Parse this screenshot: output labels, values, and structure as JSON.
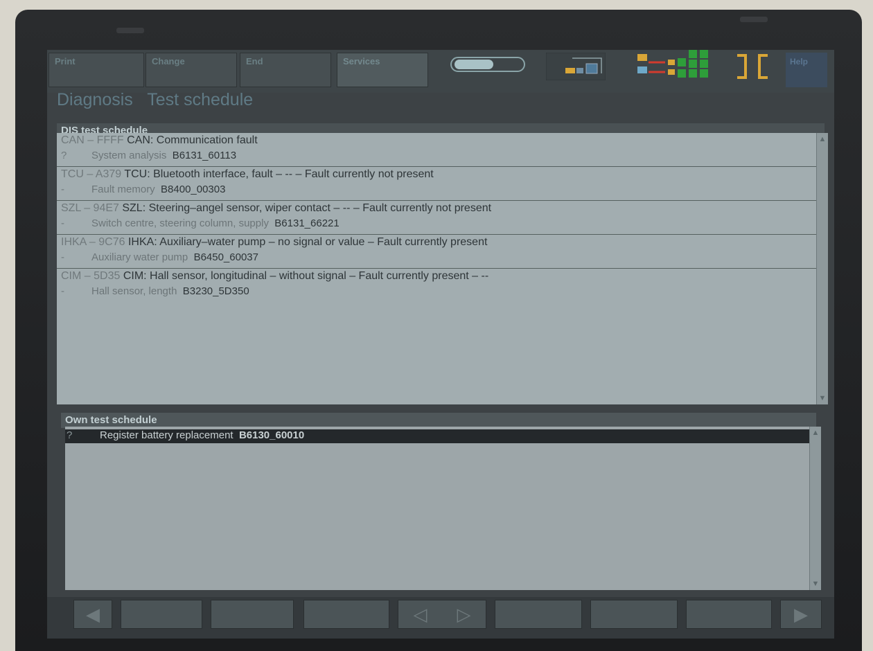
{
  "menu": {
    "items": [
      {
        "label": "Print"
      },
      {
        "label": "Change"
      },
      {
        "label": "End"
      },
      {
        "label": "Services"
      }
    ],
    "help_label": "Help"
  },
  "titles": {
    "main": "Diagnosis",
    "sub": "Test schedule"
  },
  "dis_schedule": {
    "header": "DIS test schedule",
    "rows": [
      {
        "code": "CAN – FFFF",
        "text": " CAN: Communication fault",
        "prefix": "?",
        "desc": "System analysis",
        "ref": "B6131_60113"
      },
      {
        "code": "TCU – A379",
        "text": " TCU: Bluetooth interface, fault – -- – Fault currently not present",
        "prefix": "-",
        "desc": "Fault memory",
        "ref": "B8400_00303"
      },
      {
        "code": "SZL – 94E7",
        "text": " SZL: Steering–angel sensor, wiper contact – -- –  Fault currently not present",
        "prefix": "-",
        "desc": "Switch centre, steering column, supply",
        "ref": "B6131_66221"
      },
      {
        "code": "IHKA – 9C76",
        "text": " IHKA: Auxiliary–water pump – no signal or value – Fault currently present",
        "prefix": "-",
        "desc": "Auxiliary water pump",
        "ref": "B6450_60037"
      },
      {
        "code": "CIM – 5D35",
        "text": " CIM: Hall sensor, longitudinal – without signal – Fault currently present – --",
        "prefix": "-",
        "desc": "Hall sensor, length",
        "ref": "B3230_5D350"
      }
    ]
  },
  "own_schedule": {
    "header": "Own test schedule",
    "rows": [
      {
        "prefix": "?",
        "desc": "Register battery replacement",
        "ref": "B6130_60010"
      }
    ]
  },
  "bottom_bar": {
    "left_arrow": "◀",
    "center_left_arrow": "◁",
    "center_right_arrow": "▷",
    "right_arrow": "▶"
  },
  "colors": {
    "screen_bg": "#3d4245",
    "upper_panel": "#a2adb0",
    "lower_panel": "#9da6a9",
    "selected_row": "#24282b",
    "title_accent": "#5f7a85"
  }
}
